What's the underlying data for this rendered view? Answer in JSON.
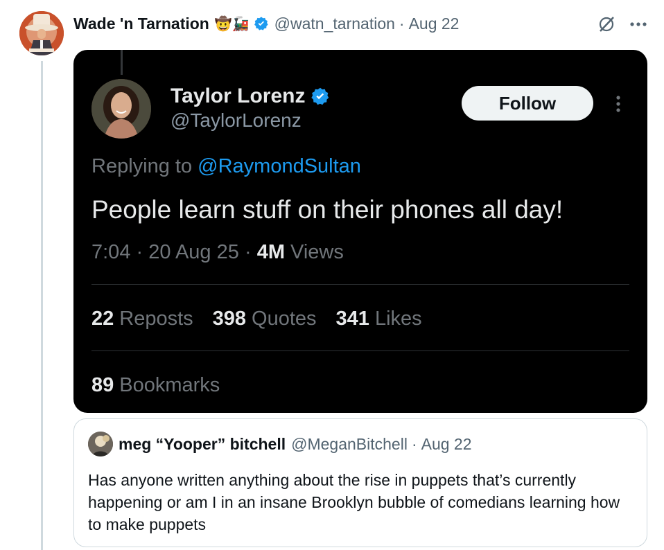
{
  "tweet": {
    "author": {
      "display_name": "Wade 'n Tarnation",
      "emojis": "🤠🚂",
      "handle": "@watn_tarnation",
      "verified": true
    },
    "separator": "·",
    "date": "Aug 22"
  },
  "embedded": {
    "author": {
      "display_name": "Taylor Lorenz",
      "handle": "@TaylorLorenz",
      "verified": true
    },
    "follow_label": "Follow",
    "replying_to_label": "Replying to",
    "replying_to_handle": "@RaymondSultan",
    "text": "People learn stuff on their phones all day!",
    "time": "7:04",
    "date": "20 Aug 25",
    "views_count": "4M",
    "views_label": "Views",
    "stats": [
      {
        "count": "22",
        "label": "Reposts"
      },
      {
        "count": "398",
        "label": "Quotes"
      },
      {
        "count": "341",
        "label": "Likes"
      }
    ],
    "bookmarks": {
      "count": "89",
      "label": "Bookmarks"
    }
  },
  "quote": {
    "author": {
      "display_name": "meg “Yooper” bitchell",
      "handle": "@MeganBitchell"
    },
    "date": "Aug 22",
    "text": "Has anyone written anything about the rise in puppets that’s currently happening or am I in an insane Brooklyn bubble of comedians learning how to make puppets"
  },
  "colors": {
    "accent": "#1d9bf0",
    "embed_bg": "#000000",
    "muted": "#536471"
  }
}
